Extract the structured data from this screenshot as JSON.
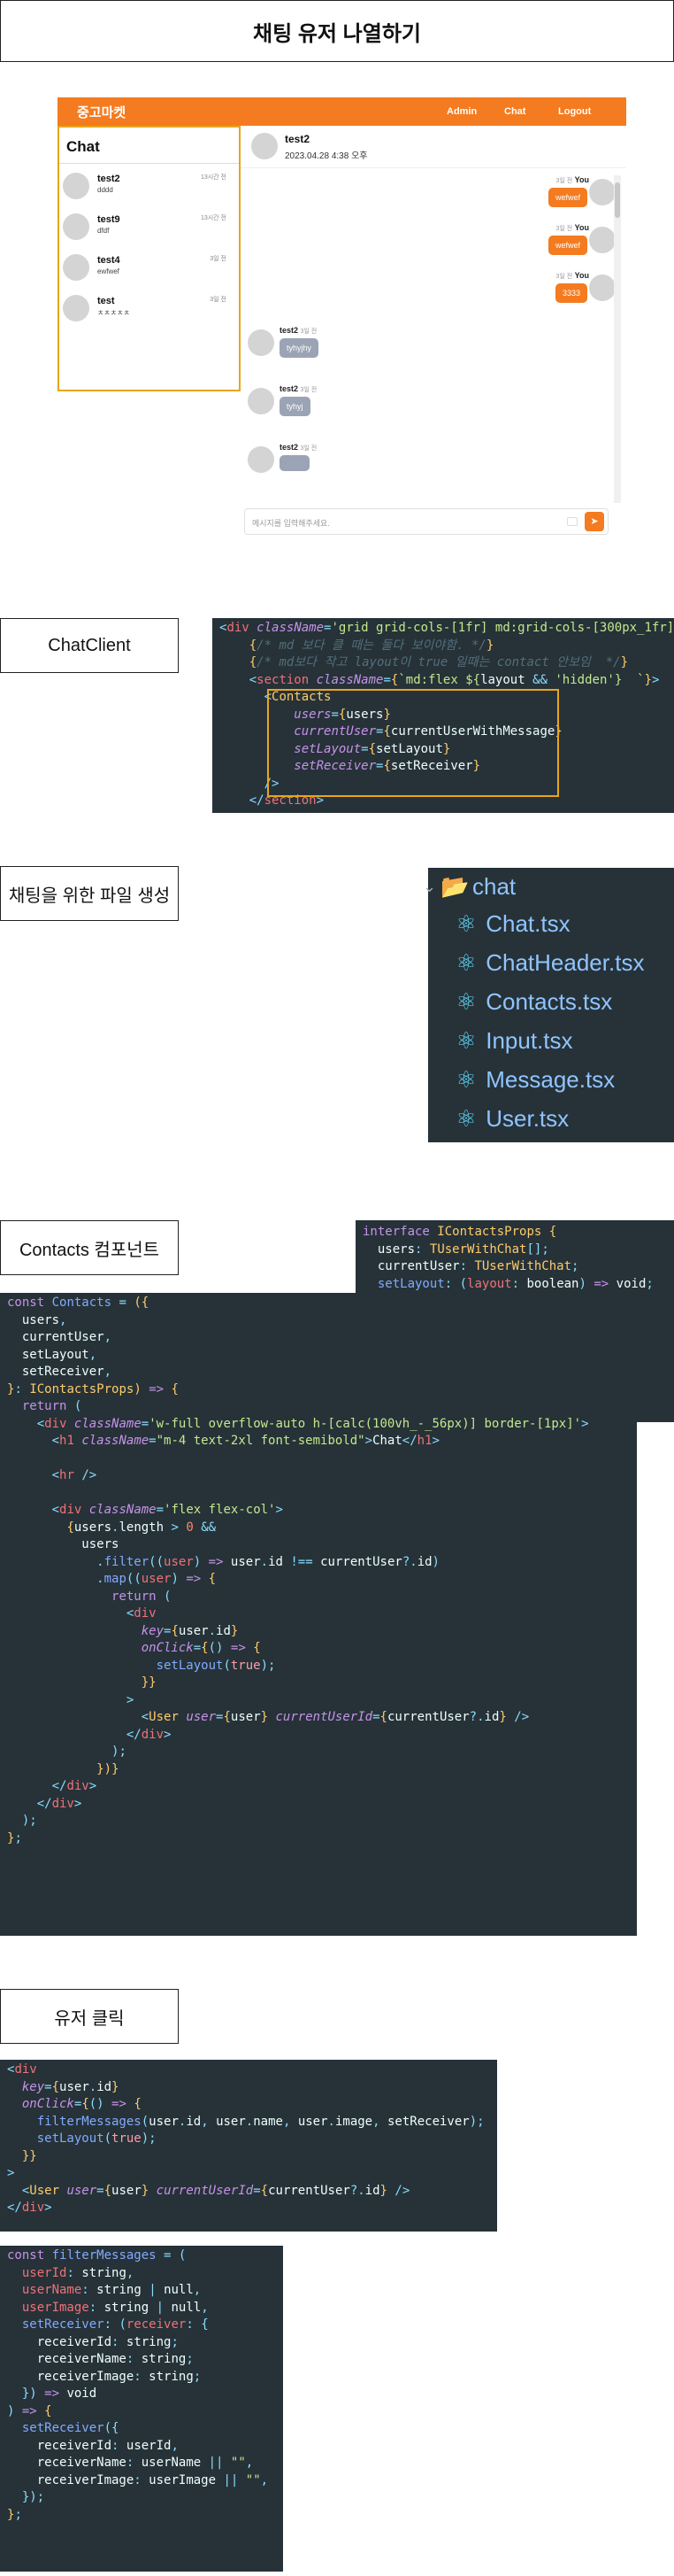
{
  "header": {
    "title": "채팅 유저 나열하기"
  },
  "app": {
    "brand": "중고마켓",
    "nav": [
      "Admin",
      "Chat",
      "Logout"
    ],
    "contacts_title": "Chat",
    "contacts": [
      {
        "name": "test2",
        "msg": "dddd",
        "time": "13시간 전"
      },
      {
        "name": "test9",
        "msg": "dfdf",
        "time": "13시간 전"
      },
      {
        "name": "test4",
        "msg": "ewfwef",
        "time": "3일 전"
      },
      {
        "name": "test",
        "msg": "ㅊㅊㅊㅊㅊ",
        "time": "3일 전"
      }
    ],
    "chat_header": {
      "name": "test2",
      "date": "2023.04.28 4:38 오후"
    },
    "messages": [
      {
        "from": "me",
        "name": "You",
        "time": "3일 전",
        "text": "wefwef"
      },
      {
        "from": "me",
        "name": "You",
        "time": "3일 전",
        "text": "wefwef"
      },
      {
        "from": "me",
        "name": "You",
        "time": "3일 전",
        "text": "3333"
      },
      {
        "from": "other",
        "name": "test2",
        "time": "3일 전",
        "text": "tyhyjhy"
      },
      {
        "from": "other",
        "name": "test2",
        "time": "3일 전",
        "text": "tyhyj"
      },
      {
        "from": "other",
        "name": "test2",
        "time": "3일 전",
        "text": ""
      }
    ],
    "input_placeholder": "메시지를 입력해주세요."
  },
  "labels": {
    "chatclient": "ChatClient",
    "files": "채팅을 위한 파일 생성",
    "contacts": "Contacts 컴포넌트",
    "userclick": "유저 클릭"
  },
  "file_tree": {
    "folder": "chat",
    "files": [
      "Chat.tsx",
      "ChatHeader.tsx",
      "Contacts.tsx",
      "Input.tsx",
      "Message.tsx",
      "User.tsx"
    ]
  },
  "colors": {
    "accent": "#f47b20",
    "highlight": "#e8a51c",
    "code_bg": "#263238"
  },
  "icons": {
    "send": "send-icon",
    "folder": "folder-icon",
    "react": "react-icon"
  }
}
